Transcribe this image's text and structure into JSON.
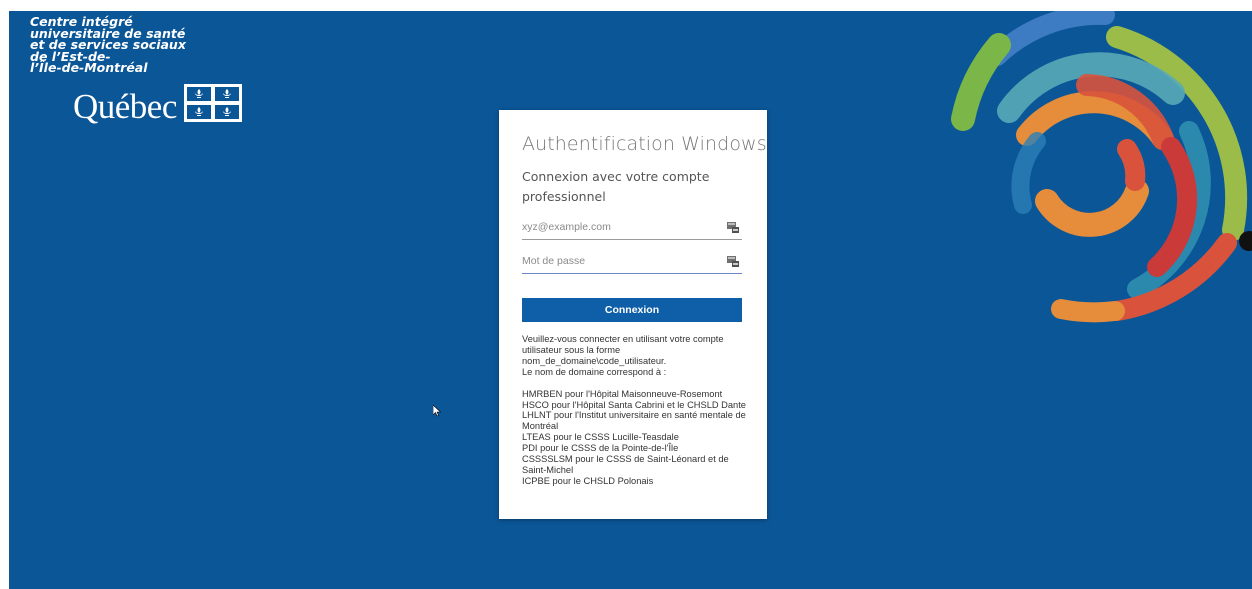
{
  "page": {
    "background_color": "#0b5697"
  },
  "logo": {
    "lines": [
      "Centre intégré",
      "universitaire de santé",
      "et de services sociaux",
      "de l’Est-de-",
      "l’Île-de-Montréal"
    ],
    "quebec_word": "Québec",
    "flag_icon": "quebec-flag-icon"
  },
  "login": {
    "title": "Authentification Windows",
    "subtitle": "Connexion avec votre compte professionnel",
    "email": {
      "value": "",
      "placeholder": "xyz@example.com",
      "icon": "key-icon"
    },
    "password": {
      "value": "",
      "placeholder": "Mot de passe",
      "icon": "key-icon"
    },
    "submit_label": "Connexion",
    "button_color": "#0f5fa8"
  },
  "help": {
    "intro": [
      "Veuillez-vous connecter en utilisant votre compte",
      "utilisateur sous la forme",
      "nom_de_domaine\\code_utilisateur.",
      "Le nom de domaine correspond à :"
    ],
    "domains": [
      "HMRBEN pour l'Hôpital Maisonneuve-Rosemont",
      "HSCO pour l'Hôpital Santa Cabrini et le CHSLD Dante",
      "LHLNT pour l'Institut universitaire en santé mentale de Montréal",
      "LTEAS pour le CSSS Lucille-Teasdale",
      "PDI pour le CSSS de la Pointe-de-l'Île",
      "CSSSSLSM pour le CSSS de Saint-Léonard et de Saint-Michel",
      "ICPBE pour le CHSLD Polonais"
    ]
  }
}
